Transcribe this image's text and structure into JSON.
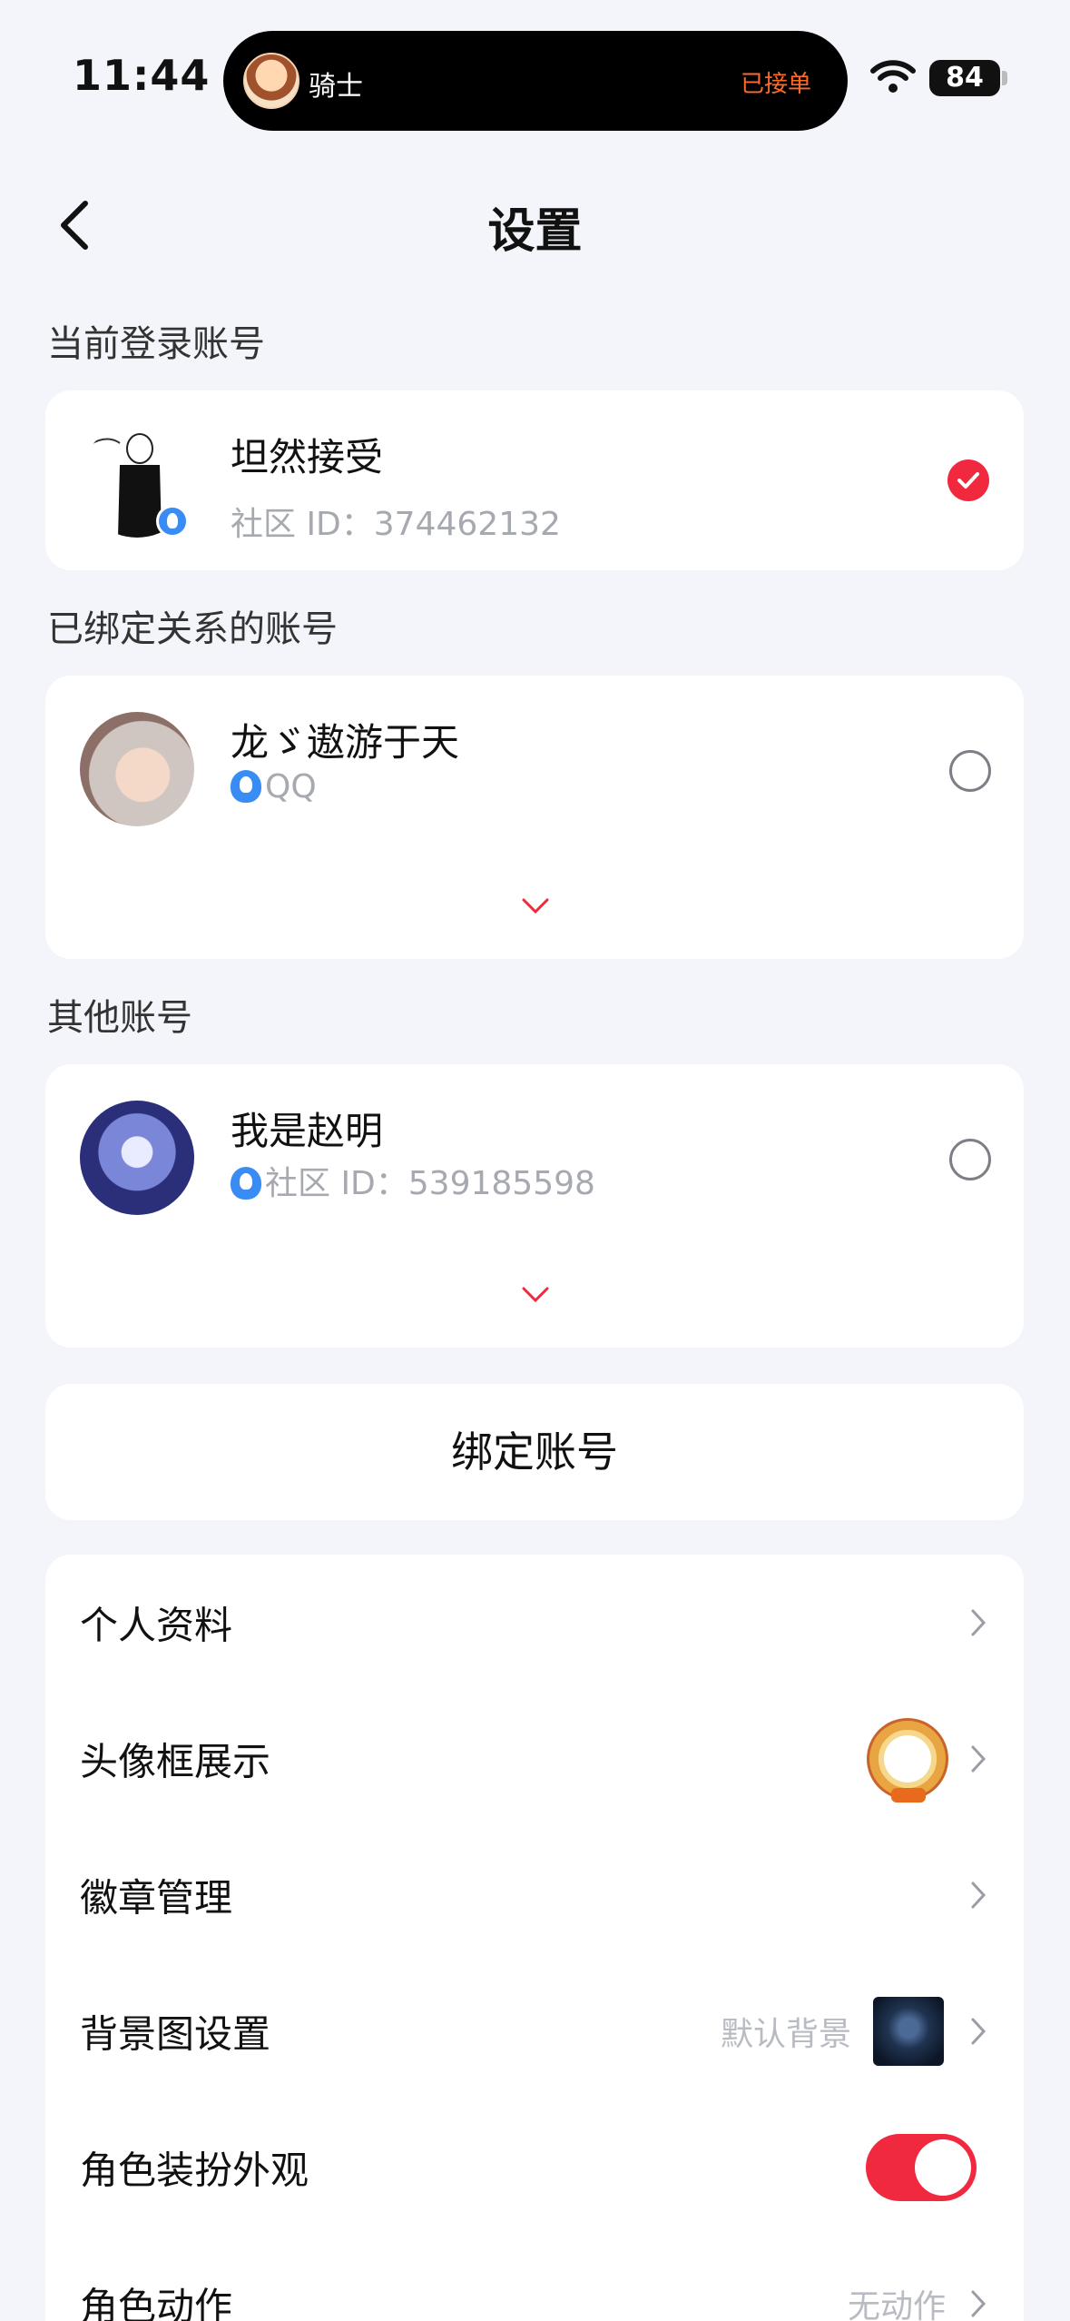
{
  "status_bar": {
    "time": "11:44",
    "island_name": "骑士",
    "island_status": "已接单",
    "battery": "84"
  },
  "header": {
    "title": "设置"
  },
  "sections": {
    "current": "当前登录账号",
    "bound": "已绑定关系的账号",
    "other": "其他账号"
  },
  "accounts": {
    "current": {
      "name": "坦然接受",
      "sub": "社区 ID：374462132",
      "selected": true
    },
    "bound": {
      "name": "龙ゞ遨游于天",
      "sub": "QQ",
      "selected": false
    },
    "other": {
      "name": "我是赵明",
      "sub": "社区 ID：539185598",
      "selected": false
    }
  },
  "bind_button": "绑定账号",
  "menu": {
    "items": [
      {
        "label": "个人资料",
        "value": ""
      },
      {
        "label": "头像框展示",
        "value": ""
      },
      {
        "label": "徽章管理",
        "value": ""
      },
      {
        "label": "背景图设置",
        "value": "默认背景"
      },
      {
        "label": "角色装扮外观",
        "value": "",
        "toggle": true
      },
      {
        "label": "角色动作",
        "value": "无动作"
      }
    ]
  },
  "colors": {
    "accent": "#f0293f",
    "background": "#f3f5fa",
    "qq_blue": "#3a8cf5",
    "island_status": "#ff6a2b"
  }
}
